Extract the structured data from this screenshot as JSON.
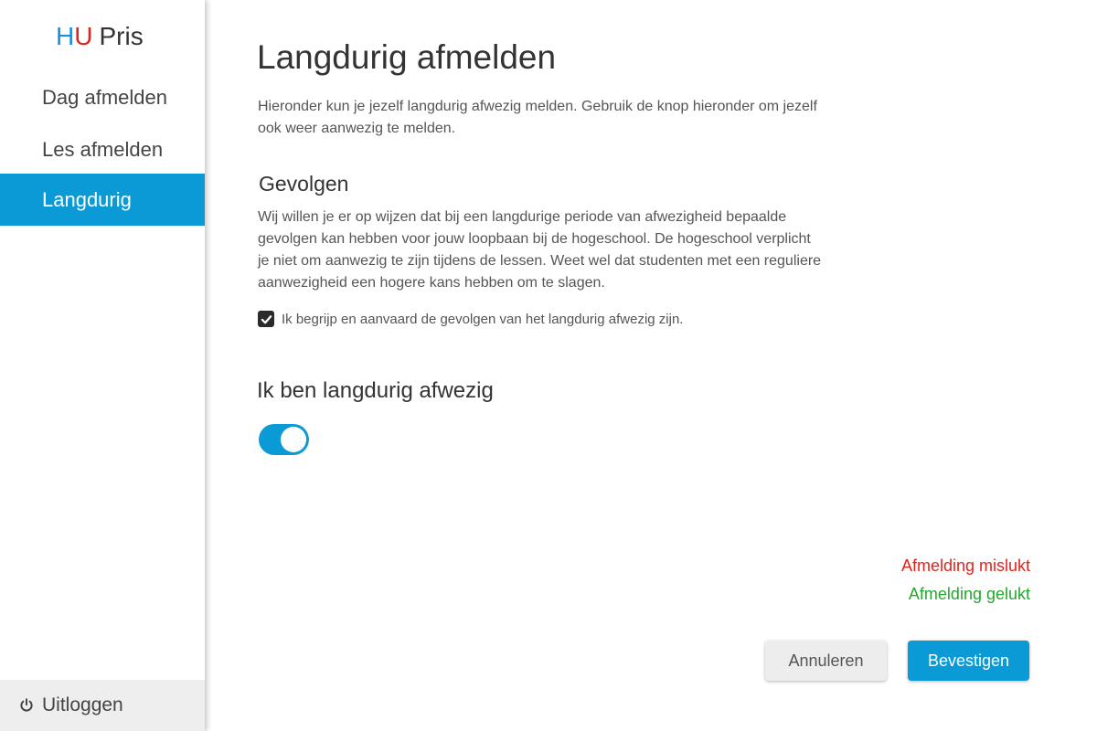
{
  "sidebar": {
    "logo": {
      "h": "H",
      "u": "U",
      "name": "Pris"
    },
    "items": [
      {
        "label": "Dag afmelden",
        "active": false
      },
      {
        "label": "Les afmelden",
        "active": false
      },
      {
        "label": "Langdurig",
        "active": true
      }
    ],
    "logout_label": "Uitloggen",
    "logout_icon": "power-icon"
  },
  "main": {
    "title": "Langdurig afmelden",
    "intro": "Hieronder kun je jezelf langdurig afwezig melden. Gebruik de knop hieronder om jezelf ook weer aanwezig te melden.",
    "gevolgen_heading": "Gevolgen",
    "gevolgen_text": "Wij willen je er op wijzen dat bij een langdurige periode van afwezigheid bepaalde gevolgen kan hebben voor jouw loopbaan bij de hogeschool. De hogeschool verplicht je niet om aanwezig te zijn tijdens de lessen. Weet wel dat studenten met een reguliere aanwezigheid een hogere kans hebben om te slagen.",
    "checkbox_label": "Ik begrijp en aanvaard de gevolgen van het langdurig afwezig zijn.",
    "checkbox_checked": true,
    "afwezig_heading": "Ik ben langdurig afwezig",
    "toggle_on": true,
    "status_failed": "Afmelding mislukt",
    "status_success": "Afmelding gelukt",
    "cancel_label": "Annuleren",
    "confirm_label": "Bevestigen"
  },
  "colors": {
    "accent": "#0a9ad6",
    "logo_h": "#1a8fd6",
    "logo_u": "#e2231a",
    "error": "#e2231a",
    "success": "#22a82c"
  }
}
